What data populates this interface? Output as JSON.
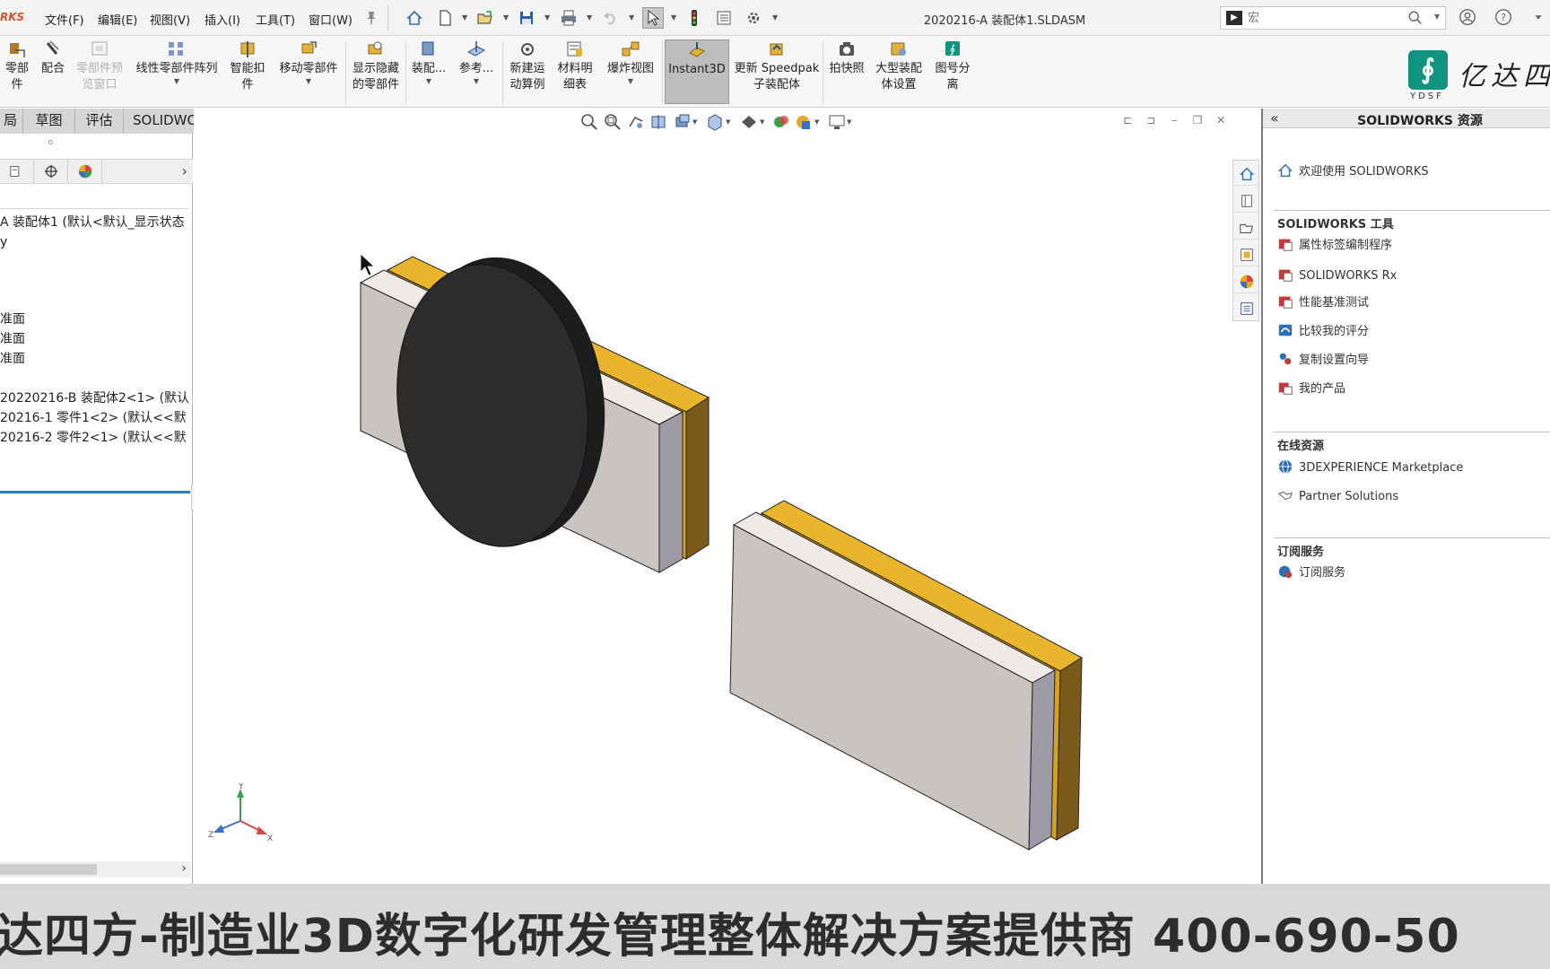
{
  "app": {
    "brand_fragment": "RKS",
    "document_title": "2020216-A 装配体1.SLDASM",
    "menu": [
      "文件(F)",
      "编辑(E)",
      "视图(V)",
      "插入(I)",
      "工具(T)",
      "窗口(W)"
    ],
    "search": {
      "cmd_glyph": "▶",
      "placeholder": "宏"
    }
  },
  "ribbon": {
    "buttons": [
      {
        "label": "零部件",
        "sub": "",
        "icon": "insert-component-icon"
      },
      {
        "label": "配合",
        "sub": "",
        "icon": "mate-icon"
      },
      {
        "label": "零部件预",
        "sub": "览窗口",
        "icon": "component-preview-icon"
      },
      {
        "label": "线性零部件阵列",
        "sub": "",
        "icon": "linear-pattern-icon"
      },
      {
        "label": "智能扣",
        "sub": "件",
        "icon": "smart-fastener-icon"
      },
      {
        "label": "移动零部件",
        "sub": "",
        "icon": "move-component-icon"
      },
      {
        "label": "显示隐藏",
        "sub": "的零部件",
        "icon": "show-hidden-icon"
      },
      {
        "label": "装配...",
        "sub": "",
        "icon": "assembly-features-icon"
      },
      {
        "label": "参考...",
        "sub": "",
        "icon": "reference-geometry-icon"
      },
      {
        "label": "新建运",
        "sub": "动算例",
        "icon": "motion-study-icon"
      },
      {
        "label": "材料明",
        "sub": "细表",
        "icon": "bom-icon"
      },
      {
        "label": "爆炸视图",
        "sub": "",
        "icon": "exploded-view-icon"
      },
      {
        "label": "Instant3D",
        "sub": "",
        "icon": "instant3d-icon"
      },
      {
        "label": "更新 Speedpak",
        "sub": "子装配体",
        "icon": "speedpak-icon"
      },
      {
        "label": "拍快照",
        "sub": "",
        "icon": "snapshot-icon"
      },
      {
        "label": "大型装配",
        "sub": "体设置",
        "icon": "large-assembly-icon"
      },
      {
        "label": "图号分",
        "sub": "离",
        "icon": "ydsf-addin-icon"
      }
    ]
  },
  "logo": {
    "mark": "∮",
    "small": "YDSF",
    "text": "亿达四"
  },
  "tabs": [
    "局",
    "草图",
    "评估",
    "SOLIDWORKS 插件"
  ],
  "tree": {
    "items": [
      "A 装配体1  (默认<默认_显示状态",
      "y",
      "准面",
      "准面",
      "准面",
      "20220216-B 装配体2<1> (默认",
      "20216-1 零件1<2> (默认<<默",
      "20216-2 零件2<1> (默认<<默"
    ]
  },
  "triad": {
    "x": "X",
    "y": "Y",
    "z": "Z"
  },
  "resources": {
    "title": "SOLIDWORKS 资源",
    "welcome": "欢迎使用  SOLIDWORKS",
    "tools_header": "SOLIDWORKS 工具",
    "tools": [
      "属性标签编制程序",
      "SOLIDWORKS Rx",
      "性能基准测试",
      "比较我的评分",
      "复制设置向导",
      "我的产品"
    ],
    "online_header": "在线资源",
    "online": [
      "3DEXPERIENCE Marketplace",
      "Partner Solutions"
    ],
    "subscription_header": "订阅服务",
    "subscription": [
      "订阅服务"
    ]
  },
  "banner": {
    "text": "达四方-制造业3D数字化研发管理整体解决方案提供商   400-690-50"
  },
  "colors": {
    "gold": "#d5a21f",
    "gold_dark": "#8a6518",
    "plate_face": "#c8c4c1",
    "plate_edge": "#9e99a6",
    "disc": "#2c2b2e",
    "accent_blue": "#2d7bbf"
  }
}
